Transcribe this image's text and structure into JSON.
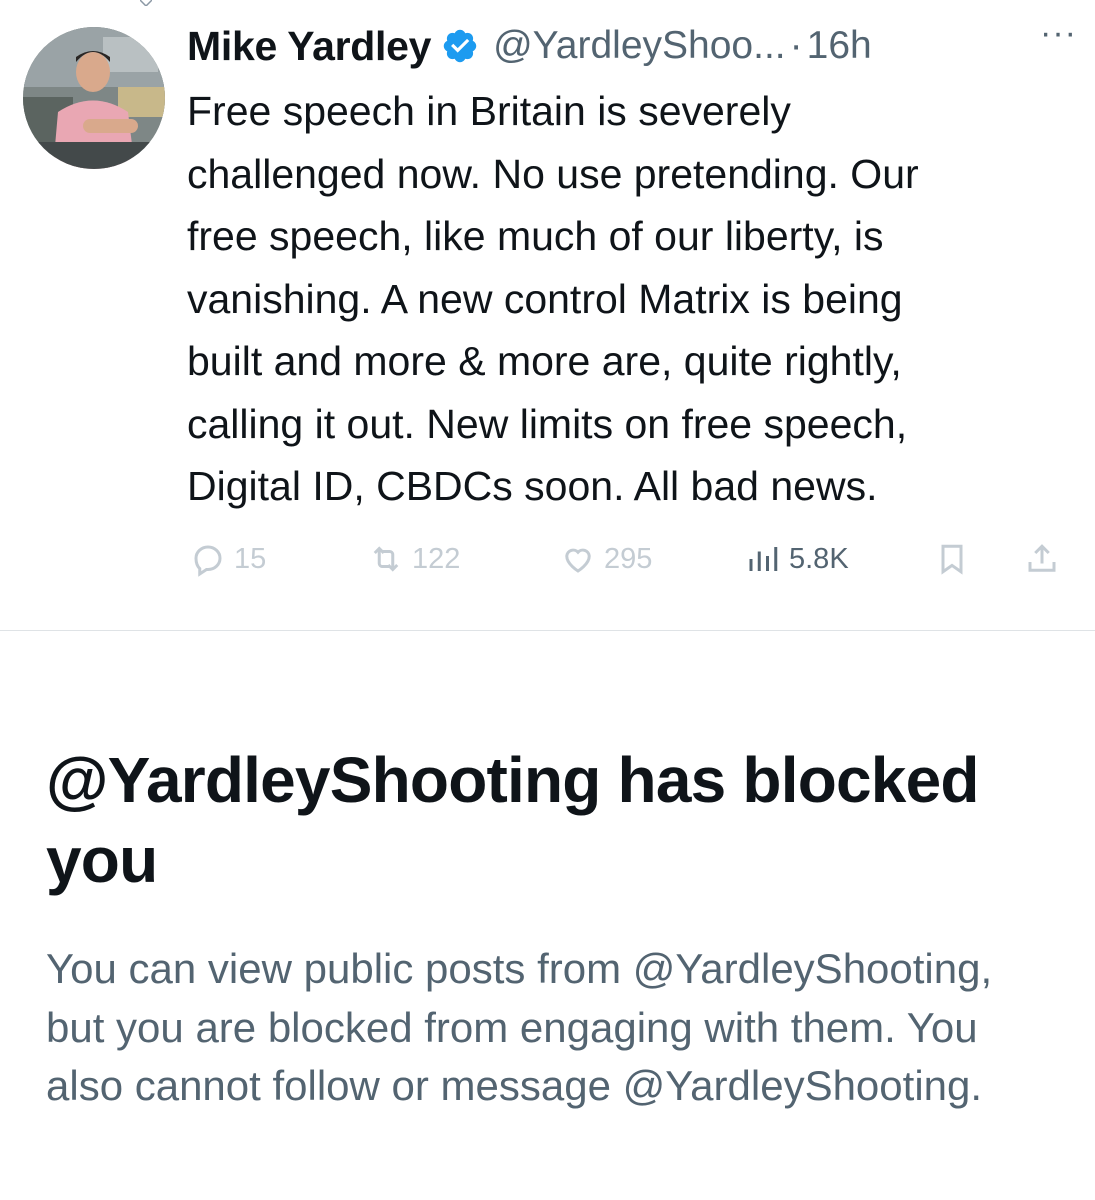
{
  "tweet": {
    "author_name": "Mike Yardley",
    "handle": "@YardleyShoo...",
    "separator": "·",
    "time": "16h",
    "more": "···",
    "text": "Free speech in Britain is severely\nchallenged now. No use pretending. Our\nfree speech, like much of our liberty, is\nvanishing. A new control Matrix is being\nbuilt and more & more are, quite rightly,\ncalling it out. New limits on free speech,\nDigital ID, CBDCs soon. All bad news.",
    "replies": "15",
    "retweets": "122",
    "likes": "295",
    "views": "5.8K",
    "icons": [
      "reply-icon",
      "retweet-icon",
      "like-icon",
      "views-icon",
      "bookmark-icon",
      "share-icon"
    ],
    "verified_color": "#1d9bf0"
  },
  "blocked": {
    "title": "@YardleyShooting has blocked you",
    "description": "You can view public posts from @YardleyShooting, but you are blocked from engaging with them. You also cannot follow or message @YardleyShooting."
  }
}
